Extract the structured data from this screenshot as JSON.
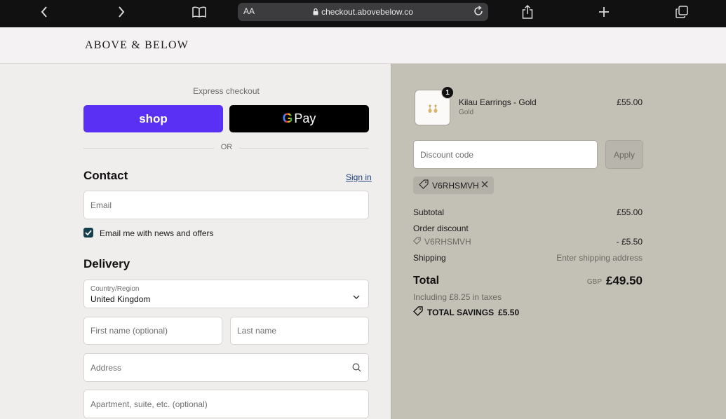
{
  "browser": {
    "text_size_label": "AA",
    "url": "checkout.abovebelow.co"
  },
  "store": {
    "logo": "ABOVE & BELOW"
  },
  "express": {
    "label": "Express checkout",
    "shop_label": "shop",
    "gpay_label": "Pay",
    "or_label": "OR"
  },
  "contact": {
    "title": "Contact",
    "sign_in": "Sign in",
    "email_placeholder": "Email",
    "newsletter_label": "Email me with news and offers",
    "newsletter_checked": true
  },
  "delivery": {
    "title": "Delivery",
    "country_label": "Country/Region",
    "country_value": "United Kingdom",
    "first_name_placeholder": "First name (optional)",
    "last_name_placeholder": "Last name",
    "address_placeholder": "Address",
    "apartment_placeholder": "Apartment, suite, etc. (optional)"
  },
  "order": {
    "item": {
      "quantity": "1",
      "name": "Kilau Earrings - Gold",
      "variant": "Gold",
      "price": "£55.00"
    },
    "discount_placeholder": "Discount code",
    "apply_label": "Apply",
    "applied_code": "V6RHSMVH",
    "subtotal_label": "Subtotal",
    "subtotal_value": "£55.00",
    "order_discount_label": "Order discount",
    "order_discount_code": "V6RHSMVH",
    "order_discount_value": "- £5.50",
    "shipping_label": "Shipping",
    "shipping_value": "Enter shipping address",
    "total_label": "Total",
    "total_currency": "GBP",
    "total_value": "£49.50",
    "taxes_note": "Including £8.25 in taxes",
    "savings_label": "TOTAL SAVINGS",
    "savings_value": "£5.50"
  },
  "colors": {
    "shop_pay": "#5a31f4",
    "checkbox": "#153e4d",
    "summary_bg": "#c3c0b6"
  }
}
